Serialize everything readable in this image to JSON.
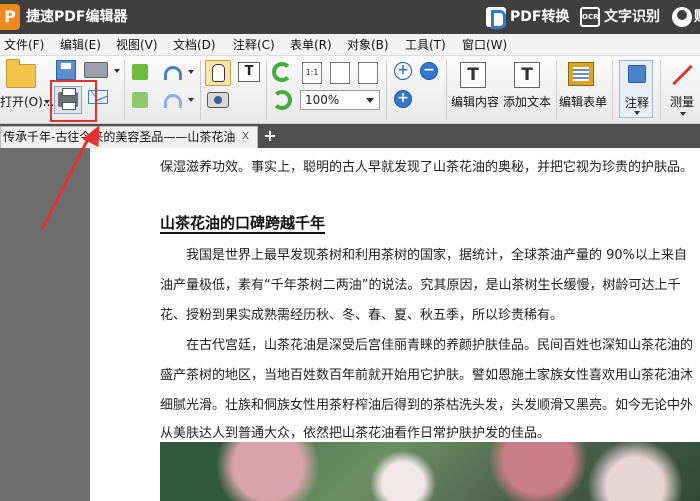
{
  "app": {
    "logo_letter": "P",
    "title": "捷速PDF编辑器"
  },
  "title_actions": {
    "pdf_convert": "PDF转换",
    "ocr_icon_text": "OCR",
    "text_recognition": "文字识别",
    "user_label": "账"
  },
  "menu": [
    "文件(F)",
    "编辑(E)",
    "视图(V)",
    "文档(D)",
    "注释(C)",
    "表单(R)",
    "对象(B)",
    "工具(T)",
    "窗口(W)"
  ],
  "toolbar": {
    "open_label": "打开(O)...",
    "select_text_glyph": "T",
    "page_actual_glyph": "1:1",
    "zoom_value": "100%",
    "zoom_in": "+",
    "zoom_out": "−",
    "zoom_plus_small": "+",
    "edit_content_label": "编辑内容",
    "add_text_label": "添加文本",
    "add_text_glyph": "T",
    "edit_content_glyph": "T",
    "edit_form_label": "编辑表单",
    "annotate_label": "注释",
    "measure_label": "测量"
  },
  "tabs": [
    {
      "label": "传承千年-古往今来的美容圣品——山茶花油",
      "close": "x"
    }
  ],
  "tab_add": "+",
  "document": {
    "line0": "保湿滋养功效。事实上，聪明的古人早就发现了山茶花油的奥秘，并把它视为珍贵的护肤品。",
    "heading": "山茶花油的口碑跨越千年",
    "p1_l1": "我国是世界上最早发现茶树和利用茶树的国家，据统计，全球茶油产量的 90%以上来自",
    "p1_l2": "油产量极低，素有“千年茶树二两油”的说法。究其原因，是山茶树生长缓慢，树龄可达上千",
    "p1_l3": "花、授粉到果实成熟需经历秋、冬、春、夏、秋五季，所以珍贵稀有。",
    "p2_l1": "在古代宫廷，山茶花油是深受后宫佳丽青睐的养颜护肤佳品。民间百姓也深知山茶花油的",
    "p2_l2": "盛产茶树的地区，当地百姓数百年前就开始用它护肤。譬如恩施土家族女性喜欢用山茶花油沐",
    "p2_l3": "细腻光滑。壮族和侗族女性用茶籽榨油后得到的茶枯洗头发，头发顺滑又黑亮。如今无论中外",
    "p2_l4": "从美肤达人到普通大众，依然把山茶花油看作日常护肤护发的佳品。"
  },
  "colors": {
    "accent": "#e3312f",
    "titlebar": "#3f3f3f",
    "logo": "#f08a1c"
  }
}
